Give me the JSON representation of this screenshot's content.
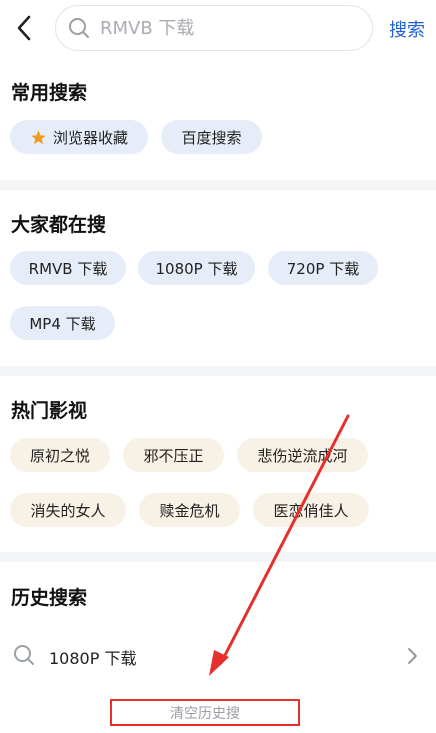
{
  "search": {
    "placeholder": "RMVB 下载",
    "button": "搜索"
  },
  "common": {
    "title": "常用搜索",
    "items": [
      {
        "label": "浏览器收藏",
        "icon": "star-icon"
      },
      {
        "label": "百度搜索"
      }
    ]
  },
  "popular": {
    "title": "大家都在搜",
    "items": [
      "RMVB 下载",
      "1080P 下载",
      "720P 下载",
      "MP4 下载"
    ]
  },
  "hot_videos": {
    "title": "热门影视",
    "items": [
      "原初之悦",
      "邪不压正",
      "悲伤逆流成河",
      "消失的女人",
      "赎金危机",
      "医恋俏佳人"
    ]
  },
  "history": {
    "title": "历史搜索",
    "items": [
      "1080P 下载"
    ],
    "clear_label": "清空历史搜"
  },
  "colors": {
    "accent": "#1f63d6",
    "annotation": "#e5302e",
    "star": "#f29b1a"
  }
}
